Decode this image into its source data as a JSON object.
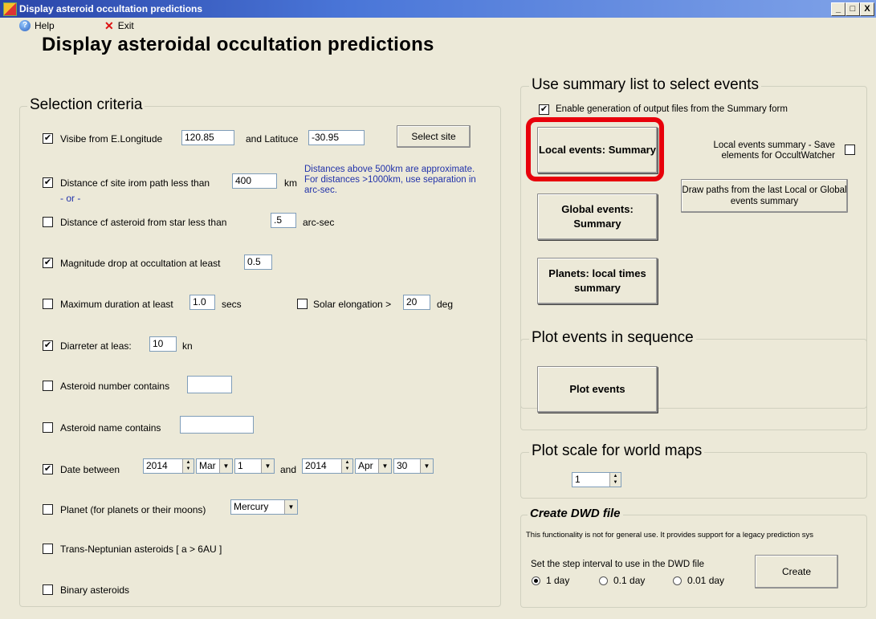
{
  "window": {
    "title": "Display asteroid occultation predictions",
    "controls": [
      "_",
      "□",
      "X"
    ]
  },
  "menu": {
    "help": "Help",
    "exit": "Exit"
  },
  "heading": "Display asteroidal occultation predictions",
  "selection": {
    "title": "Selection criteria",
    "visible": {
      "checked": true,
      "label": "Visibe from E.Longitude",
      "longitude": "120.85",
      "and_label": "and Latituce",
      "latitude": "-30.95",
      "select_site": "Select site"
    },
    "distance_site": {
      "checked": true,
      "label": "Distance cf site irom path less than",
      "value": "400",
      "unit": "km"
    },
    "distance_note": "Distances above 500km are approximate. For distances >1000km, use separation in arc-sec.",
    "or_label": "- or -",
    "distance_asteroid": {
      "checked": false,
      "label": "Distance cf asteroid from star less than",
      "value": ".5",
      "unit": "arc-sec"
    },
    "mag_drop": {
      "checked": true,
      "label": "Magnitude drop at occultation at least",
      "value": "0.5"
    },
    "max_duration": {
      "checked": false,
      "label": "Maximum duration at least",
      "value": "1.0",
      "unit": "secs"
    },
    "solar_elong": {
      "checked": false,
      "label": "Solar elongation >",
      "value": "20",
      "unit": "deg"
    },
    "diameter": {
      "checked": true,
      "label": "Diarreter at leas:",
      "value": "10",
      "unit": "kn"
    },
    "asteroid_number": {
      "checked": false,
      "label": "Asteroid number contains",
      "value": ""
    },
    "asteroid_name": {
      "checked": false,
      "label": "Asteroid name contains",
      "value": ""
    },
    "date": {
      "checked": true,
      "label": "Date between",
      "year1": "2014",
      "month1": "Mar",
      "day1": "1",
      "and_label": "and",
      "year2": "2014",
      "month2": "Apr",
      "day2": "30"
    },
    "planet": {
      "checked": false,
      "label": "Planet (for planets or their moons)",
      "value": "Mercury"
    },
    "tno": {
      "checked": false,
      "label": "Trans-Neptunian asteroids [ a > 6AU ]"
    },
    "binary": {
      "checked": false,
      "label": "Binary asteroids"
    }
  },
  "summary": {
    "title": "Use summary list to select events",
    "enable_output": {
      "checked": true,
      "label": "Enable generation of output files from the Summary form"
    },
    "local_events_btn": "Local events: Summary",
    "global_events_btn": "Global events: Summary",
    "planets_btn": "Planets: local times summary",
    "save_elements": {
      "checked": false,
      "label": "Local events summary - Save elements for OccultWatcher"
    },
    "draw_paths_btn": "Draw paths from the last Local or Global events summary"
  },
  "plot": {
    "title": "Plot events in sequence",
    "button": "Plot events"
  },
  "scale": {
    "title": "Plot scale for world maps",
    "value": "1"
  },
  "dwd": {
    "title": "Create DWD file",
    "note": "This functionality is not for general use. It provides support for a legacy prediction sys",
    "step_label": "Set the step interval to use in the DWD file",
    "options": [
      "1 day",
      "0.1 day",
      "0.01 day"
    ],
    "selected": "1 day",
    "create_btn": "Create"
  },
  "highlight_color": "#e8000b"
}
